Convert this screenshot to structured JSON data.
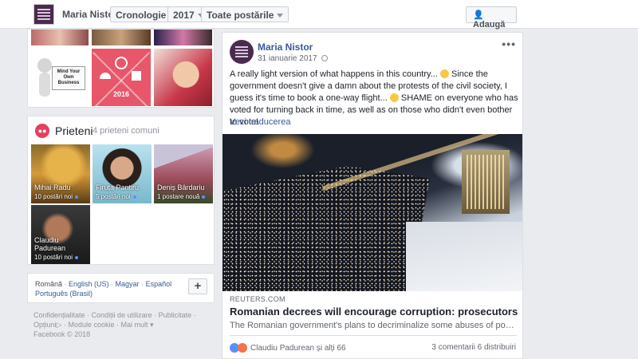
{
  "topbar": {
    "profile_name": "Maria Nistor",
    "timeline_label": "Cronologie",
    "year_label": "2017",
    "posts_filter_label": "Toate postările",
    "add_button_label": "Adaugă"
  },
  "photos": {
    "mind_sign_text": "Mind Your Own Business",
    "year_tile_text": "2016"
  },
  "friends": {
    "title": "Prieteni",
    "subtitle": "4 prieteni comuni",
    "items": [
      {
        "name": "Mihai Radu",
        "posts": "10 postări noi"
      },
      {
        "name": "Firuța Pantiru",
        "posts": "5 postări noi"
      },
      {
        "name": "Deniș Bârdariu",
        "posts": "1 postare nouă"
      },
      {
        "name": "Claudiu Padurean",
        "posts": "10 postări noi"
      }
    ]
  },
  "languages": {
    "current": "Română",
    "options": [
      "English (US)",
      "Magyar",
      "Español",
      "Português (Brasil)"
    ],
    "add_label": "+"
  },
  "footer": {
    "links_row1": [
      "Confidențialitate",
      "Condiții de utilizare",
      "Publicitate"
    ],
    "links_row2": [
      "Opțiuni",
      "Module cookie",
      "Mai mult"
    ],
    "copyright": "Facebook © 2018"
  },
  "post": {
    "author": "Maria Nistor",
    "date": "31 ianuarie 2017",
    "text_part1": "A really light version of what happens in this country...",
    "text_part2": "Since the government doesn't give a damn about the protests of the civil society, I guess it's time to book a one-way flight...",
    "text_part3": "SHAME on everyone who has voted for turning back in time, as well as on those who didn't even bother to vote!",
    "translate_label": "Vezi traducerea",
    "link_source": "REUTERS.COM",
    "link_headline": "Romanian decrees will encourage corruption: prosecutors",
    "link_description": "The Romanian government's plans to decriminalize some abuses of power...",
    "reactions_text": "Claudiu Padurean și alți 66",
    "comments_count": "3 comentarii",
    "shares_count": "6 distribuiri"
  },
  "colors": {
    "link_blue": "#385898",
    "accent_pink": "#e4405f"
  }
}
